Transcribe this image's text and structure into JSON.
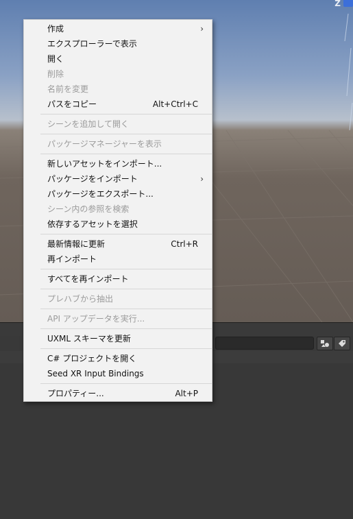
{
  "scene": {
    "gizmo_axis_label": "Z"
  },
  "context_menu": {
    "items": [
      {
        "label": "作成",
        "shortcut": "",
        "submenu": true,
        "enabled": true
      },
      {
        "label": "エクスプローラーで表示",
        "shortcut": "",
        "submenu": false,
        "enabled": true
      },
      {
        "label": "開く",
        "shortcut": "",
        "submenu": false,
        "enabled": true
      },
      {
        "label": "削除",
        "shortcut": "",
        "submenu": false,
        "enabled": false
      },
      {
        "label": "名前を変更",
        "shortcut": "",
        "submenu": false,
        "enabled": false
      },
      {
        "label": "パスをコピー",
        "shortcut": "Alt+Ctrl+C",
        "submenu": false,
        "enabled": true
      },
      {
        "label": "シーンを追加して開く",
        "shortcut": "",
        "submenu": false,
        "enabled": false
      },
      {
        "label": "パッケージマネージャーを表示",
        "shortcut": "",
        "submenu": false,
        "enabled": false
      },
      {
        "label": "新しいアセットをインポート...",
        "shortcut": "",
        "submenu": false,
        "enabled": true
      },
      {
        "label": "パッケージをインポート",
        "shortcut": "",
        "submenu": true,
        "enabled": true
      },
      {
        "label": "パッケージをエクスポート...",
        "shortcut": "",
        "submenu": false,
        "enabled": true
      },
      {
        "label": "シーン内の参照を検索",
        "shortcut": "",
        "submenu": false,
        "enabled": false
      },
      {
        "label": "依存するアセットを選択",
        "shortcut": "",
        "submenu": false,
        "enabled": true
      },
      {
        "label": "最新情報に更新",
        "shortcut": "Ctrl+R",
        "submenu": false,
        "enabled": true
      },
      {
        "label": "再インポート",
        "shortcut": "",
        "submenu": false,
        "enabled": true
      },
      {
        "label": "すべてを再インポート",
        "shortcut": "",
        "submenu": false,
        "enabled": true
      },
      {
        "label": "プレハブから抽出",
        "shortcut": "",
        "submenu": false,
        "enabled": false
      },
      {
        "label": "API アップデータを実行...",
        "shortcut": "",
        "submenu": false,
        "enabled": false
      },
      {
        "label": "UXML スキーマを更新",
        "shortcut": "",
        "submenu": false,
        "enabled": true
      },
      {
        "label": "C# プロジェクトを開く",
        "shortcut": "",
        "submenu": false,
        "enabled": true
      },
      {
        "label": "Seed XR Input Bindings",
        "shortcut": "",
        "submenu": false,
        "enabled": true
      },
      {
        "label": "プロパティー...",
        "shortcut": "Alt+P",
        "submenu": false,
        "enabled": true
      }
    ],
    "submenu_arrow": "›"
  }
}
